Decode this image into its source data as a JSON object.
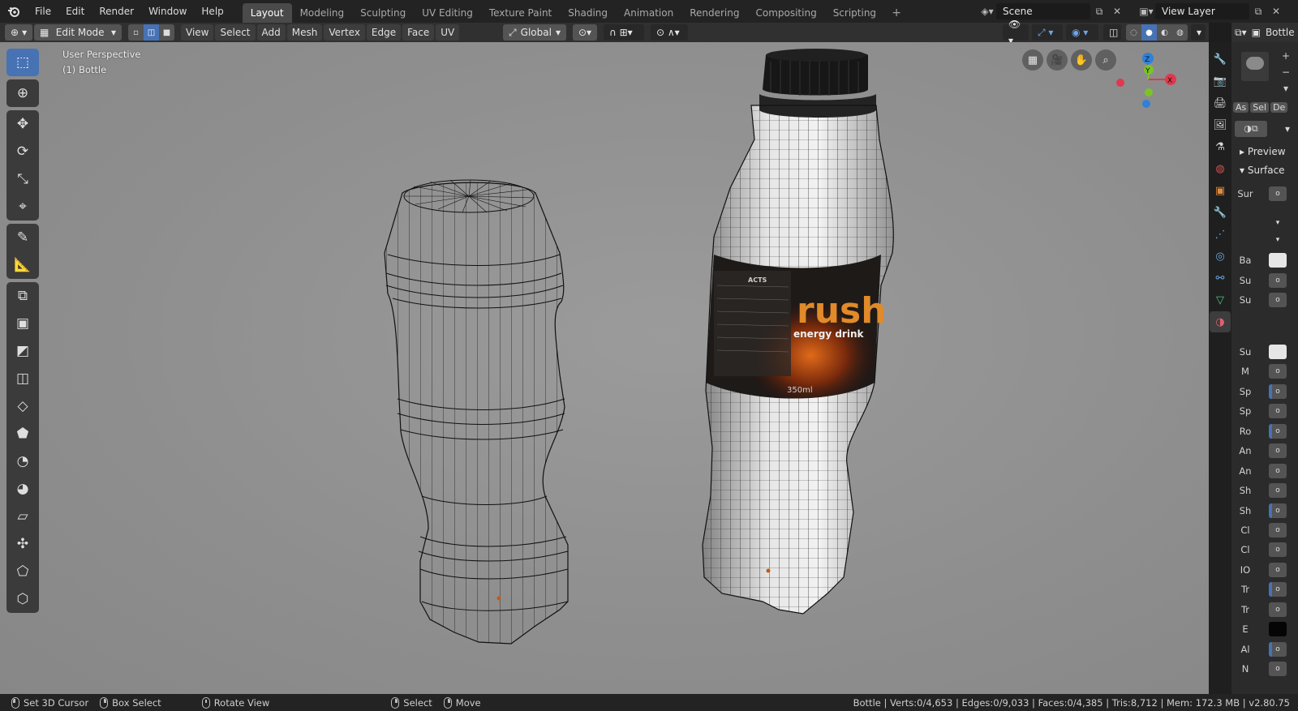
{
  "menu": [
    "File",
    "Edit",
    "Render",
    "Window",
    "Help"
  ],
  "workspaces": [
    "Layout",
    "Modeling",
    "Sculpting",
    "UV Editing",
    "Texture Paint",
    "Shading",
    "Animation",
    "Rendering",
    "Compositing",
    "Scripting"
  ],
  "active_workspace": "Layout",
  "add_workspace": "+",
  "scene_name": "Scene",
  "view_layer_name": "View Layer",
  "header": {
    "mode": "Edit Mode",
    "menus": [
      "View",
      "Select",
      "Add",
      "Mesh",
      "Vertex",
      "Edge",
      "Face",
      "UV"
    ],
    "transform_orientation": "Global"
  },
  "viewport": {
    "view_name": "User Perspective",
    "object_info": "(1) Bottle",
    "label_text": "rush",
    "label_subtext": "energy drink",
    "label_volume": "350ml",
    "label_facts": "ACTS"
  },
  "gizmo": {
    "x": "X",
    "y": "Y",
    "z": "Z",
    "x_color": "#e0384f",
    "y_color": "#7cc425",
    "z_color": "#2f80d9"
  },
  "properties": {
    "object_name": "Bottle",
    "tabs_row": [
      "As",
      "Sel",
      "De"
    ],
    "preview_label": "Preview",
    "surface_label": "Surface",
    "surface_field": "Sur",
    "rows": [
      "Ba",
      "Su",
      "Su",
      "Su",
      "M",
      "Sp",
      "Sp",
      "Ro",
      "An",
      "An",
      "Sh",
      "Sh",
      "Cl",
      "Cl",
      "IO",
      "Tr",
      "Tr",
      "E",
      "Al",
      "N"
    ]
  },
  "status": {
    "hints": [
      "Set 3D Cursor",
      "Box Select",
      "Rotate View",
      "Select",
      "Move"
    ],
    "stats": "Bottle | Verts:0/4,653 | Edges:0/9,033 | Faces:0/4,385 | Tris:8,712 | Mem: 172.3 MB | v2.80.75"
  },
  "accent_color": "#4772b3"
}
